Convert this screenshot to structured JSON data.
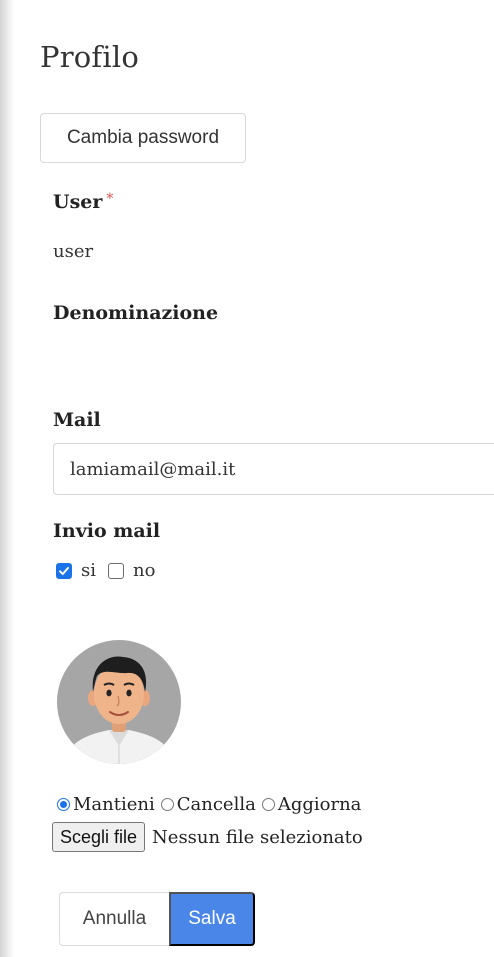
{
  "page": {
    "title": "Profilo"
  },
  "actions": {
    "change_password": "Cambia password"
  },
  "form": {
    "user": {
      "label": "User",
      "required_mark": "*",
      "value": "user"
    },
    "denominazione": {
      "label": "Denominazione",
      "value": ""
    },
    "mail": {
      "label": "Mail",
      "value": "lamiamail@mail.it"
    },
    "invio_mail": {
      "label": "Invio mail",
      "options": [
        {
          "label": "si",
          "checked": true
        },
        {
          "label": "no",
          "checked": false
        }
      ]
    },
    "avatar": {
      "icon": "user-avatar-icon",
      "options": [
        {
          "label": "Mantieni",
          "selected": true
        },
        {
          "label": "Cancella",
          "selected": false
        },
        {
          "label": "Aggiorna",
          "selected": false
        }
      ],
      "file_button": "Scegli file",
      "file_status": "Nessun file selezionato"
    }
  },
  "footer": {
    "cancel_label": "Annulla",
    "save_label": "Salva"
  },
  "colors": {
    "primary": "#4a86e8",
    "check": "#1a73e8",
    "required": "#d9534f"
  }
}
